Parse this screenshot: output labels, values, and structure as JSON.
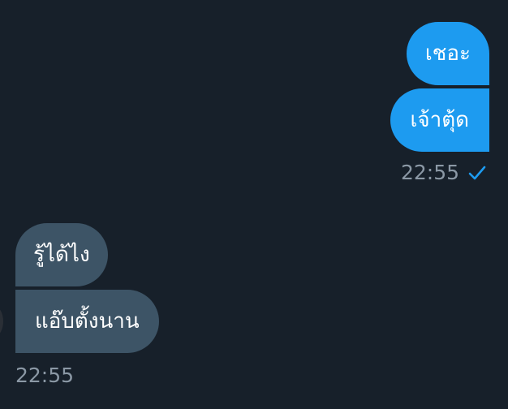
{
  "chat": {
    "outgoing": [
      {
        "text": "เชอะ"
      },
      {
        "text": "เจ้าตุ้ด"
      }
    ],
    "outgoing_time": "22:55",
    "outgoing_status_icon": "check-icon",
    "incoming": [
      {
        "text": "รู้ได้ไง"
      },
      {
        "text": "แอ๊บตั้งนาน"
      }
    ],
    "incoming_time": "22:55"
  },
  "colors": {
    "background": "#17202a",
    "outgoing_bubble": "#1d9bf0",
    "incoming_bubble": "#3d5466",
    "timestamp": "#8b98a5",
    "check": "#1d9bf0"
  }
}
